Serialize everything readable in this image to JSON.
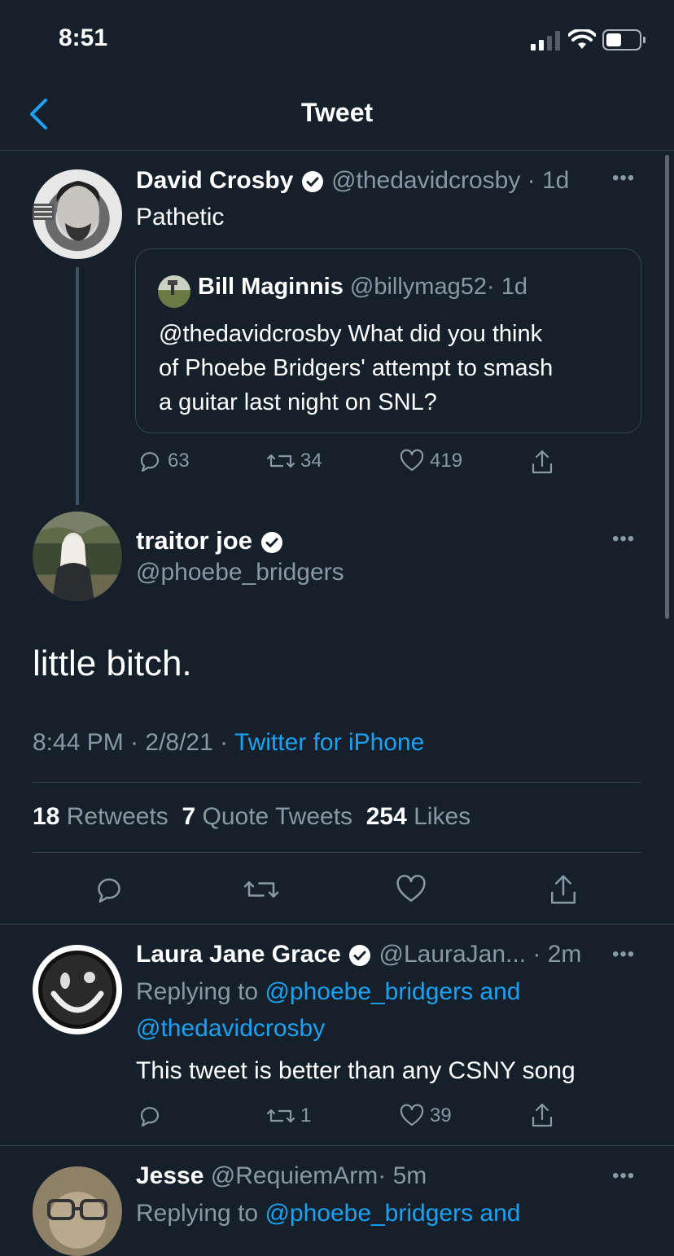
{
  "status_bar": {
    "time": "8:51"
  },
  "nav": {
    "title": "Tweet"
  },
  "thread_parent": {
    "name": "David Crosby",
    "handle": "@thedavidcrosby",
    "time": "· 1d",
    "text": "Pathetic",
    "quoted": {
      "name": "Bill Maginnis",
      "handle": "@billymag52",
      "time": "· 1d",
      "text_line1": "@thedavidcrosby What did you think",
      "text_line2": "of Phoebe Bridgers' attempt to smash",
      "text_line3": "a guitar last night on SNL?"
    },
    "actions": {
      "replies": "63",
      "retweets": "34",
      "likes": "419"
    }
  },
  "main_tweet": {
    "name": "traitor joe",
    "handle": "@phoebe_bridgers",
    "text": "little bitch.",
    "time": "8:44 PM · 2/8/21 ·",
    "source": "Twitter for iPhone",
    "stats": {
      "retweets_count": "18",
      "retweets_label": "Retweets",
      "quotes_count": "7",
      "quotes_label": "Quote Tweets",
      "likes_count": "254",
      "likes_label": "Likes"
    }
  },
  "replies": [
    {
      "name": "Laura Jane Grace",
      "handle": "@LauraJan...",
      "time": "· 2m",
      "replying_prefix": "Replying to",
      "replying_line1": "@phoebe_bridgers and",
      "replying_line2": "@thedavidcrosby",
      "text": "This tweet is better than any CSNY song",
      "actions": {
        "retweets": "1",
        "likes": "39"
      }
    },
    {
      "name": "Jesse",
      "handle": "@RequiemArm",
      "time": "· 5m",
      "replying_prefix": "Replying to",
      "replying_line1": "@phoebe_bridgers and"
    }
  ],
  "colors": {
    "background": "#15202b",
    "accent": "#1da1f2",
    "muted": "#8899a6",
    "divider": "#38444d"
  }
}
